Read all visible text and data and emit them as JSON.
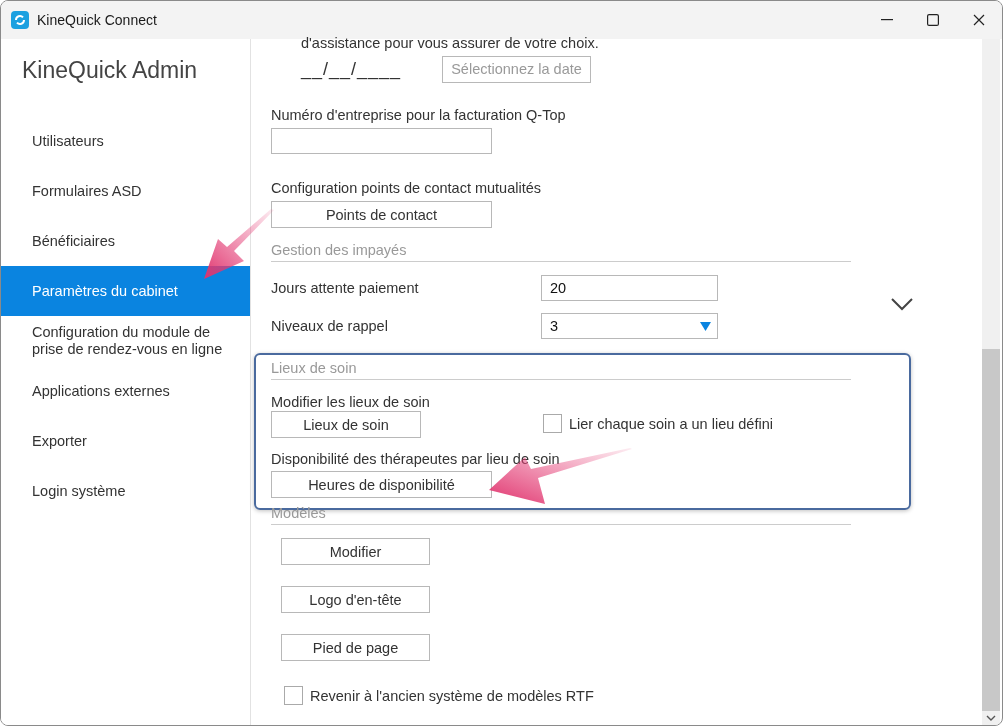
{
  "window": {
    "title": "KineQuick Connect"
  },
  "sidebar": {
    "title": "KineQuick Admin",
    "items": [
      {
        "label": "Utilisateurs",
        "selected": false
      },
      {
        "label": "Formulaires ASD",
        "selected": false
      },
      {
        "label": "Bénéficiaires",
        "selected": false
      },
      {
        "label": "Paramètres du cabinet",
        "selected": true
      },
      {
        "label": "Configuration du module de prise de rendez-vous en ligne",
        "selected": false
      },
      {
        "label": "Applications externes",
        "selected": false
      },
      {
        "label": "Exporter",
        "selected": false
      },
      {
        "label": "Login système",
        "selected": false
      }
    ]
  },
  "content": {
    "intro_text": "d'assistance pour vous assurer de votre choix.",
    "date": {
      "value": "__/__/____",
      "button": "Sélectionnez la date",
      "disabled": true
    },
    "company_number": {
      "label": "Numéro d'entreprise pour la facturation Q-Top"
    },
    "contact_points": {
      "label": "Configuration points de contact mutualités",
      "button": "Points de contact"
    },
    "unpaid": {
      "title": "Gestion des impayés",
      "rows": [
        {
          "kind": "text",
          "label": "Jours attente paiement",
          "value": "20"
        },
        {
          "kind": "select",
          "label": "Niveaux de rappel",
          "value": "3"
        }
      ]
    },
    "care_places": {
      "title": "Lieux de soin",
      "highlighted": true,
      "edit_label": "Modifier les lieux de soin",
      "edit_button": "Lieux de soin",
      "checkbox": {
        "label": "Lier chaque soin a un lieu défini",
        "checked": false
      },
      "availability_label": "Disponibilité des thérapeutes par lieu de soin",
      "availability_button": "Heures de disponibilité"
    },
    "templates": {
      "title": "Modèles",
      "buttons": [
        "Modifier",
        "Logo d'en-tête",
        "Pied de page"
      ],
      "checkbox": {
        "label": "Revenir à l'ancien système de modèles RTF",
        "checked": false
      }
    }
  }
}
